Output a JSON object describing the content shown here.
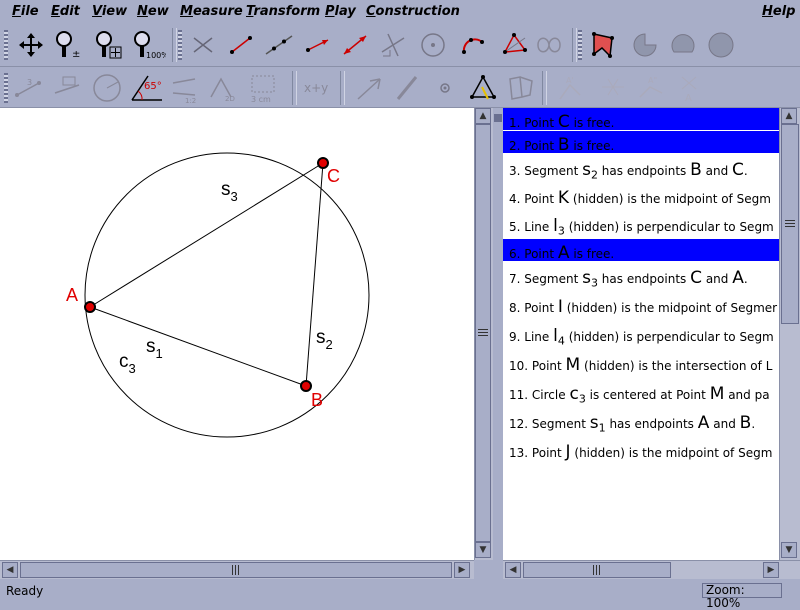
{
  "menu": {
    "items": [
      {
        "label": "File",
        "accel": "F",
        "rest": "ile"
      },
      {
        "label": "Edit",
        "accel": "E",
        "rest": "dit"
      },
      {
        "label": "View",
        "accel": "V",
        "rest": "iew"
      },
      {
        "label": "New",
        "accel": "N",
        "rest": "ew"
      },
      {
        "label": "Measure",
        "accel": "M",
        "rest": "easure"
      },
      {
        "label": "Transform",
        "accel": "T",
        "rest": "ransform"
      },
      {
        "label": "Play",
        "accel": "P",
        "rest": "lay"
      },
      {
        "label": "Construction",
        "accel": "C",
        "rest": "onstruction"
      }
    ],
    "help": {
      "label": "Help",
      "accel": "H",
      "rest": "elp"
    }
  },
  "toolbar": {
    "zoom_label": "100%",
    "angle_label": "65°",
    "two_d_label": "2D",
    "xy_label": "x+y",
    "cm_label": "3 cm"
  },
  "canvas": {
    "points": [
      {
        "label": "A"
      },
      {
        "label": "B"
      },
      {
        "label": "C"
      }
    ],
    "segment_labels": [
      {
        "name": "s",
        "sub": "3"
      },
      {
        "name": "s",
        "sub": "2"
      },
      {
        "name": "s",
        "sub": "1"
      }
    ],
    "circle_label": {
      "name": "c",
      "sub": "3"
    },
    "point_color": "#e00000"
  },
  "steps": [
    {
      "num": "1.",
      "parts": [
        "Point",
        "C",
        "is free."
      ],
      "selected": true
    },
    {
      "num": "2.",
      "parts": [
        "Point",
        "B",
        "is free."
      ],
      "selected": true
    },
    {
      "num": "3.",
      "parts": [
        "Segment",
        "s",
        "2",
        "has endpoints",
        "B",
        "and",
        "C",
        "."
      ],
      "selected": false
    },
    {
      "num": "4.",
      "parts": [
        "Point",
        "K",
        "(hidden)",
        "is the midpoint of Segm"
      ],
      "selected": false
    },
    {
      "num": "5.",
      "parts": [
        "Line",
        "l",
        "3",
        "(hidden)",
        "is perpendicular to Segm"
      ],
      "selected": false
    },
    {
      "num": "6.",
      "parts": [
        "Point",
        "A",
        "is free."
      ],
      "selected": true
    },
    {
      "num": "7.",
      "parts": [
        "Segment",
        "s",
        "3",
        "has endpoints",
        "C",
        "and",
        "A",
        "."
      ],
      "selected": false
    },
    {
      "num": "8.",
      "parts": [
        "Point",
        "I",
        "(hidden)",
        "is the midpoint of Segmer"
      ],
      "selected": false
    },
    {
      "num": "9.",
      "parts": [
        "Line",
        "l",
        "4",
        "(hidden)",
        "is perpendicular to Segm"
      ],
      "selected": false
    },
    {
      "num": "10.",
      "parts": [
        "Point",
        "M",
        "(hidden)",
        "is the intersection of L"
      ],
      "selected": false
    },
    {
      "num": "11.",
      "parts": [
        "Circle",
        "c",
        "3",
        "is centered at Point",
        "M",
        "and pa"
      ],
      "selected": false
    },
    {
      "num": "12.",
      "parts": [
        "Segment",
        "s",
        "1",
        "has endpoints",
        "A",
        "and",
        "B",
        "."
      ],
      "selected": false
    },
    {
      "num": "13.",
      "parts": [
        "Point",
        "J",
        "(hidden)",
        "is the midpoint of Segm"
      ],
      "selected": false
    }
  ],
  "status": {
    "text": "Ready",
    "zoom": "Zoom: 100%"
  },
  "colors": {
    "background": "#a8aec8",
    "selection": "#0000ff",
    "point_fill": "#e00000"
  }
}
